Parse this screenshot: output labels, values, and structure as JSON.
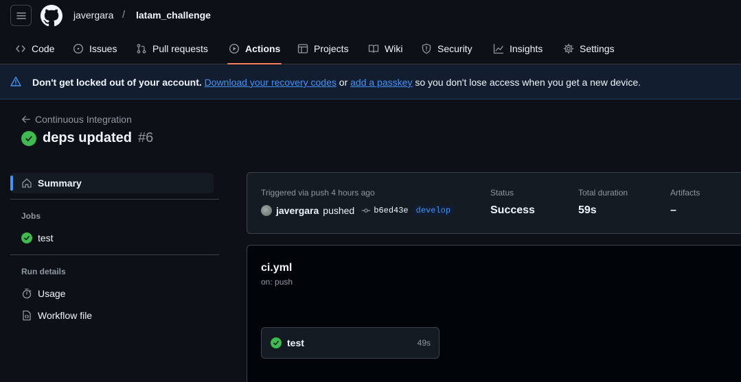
{
  "header": {
    "owner": "javergara",
    "separator": "/",
    "repo": "latam_challenge"
  },
  "tabs": [
    {
      "label": "Code",
      "icon": "code-icon"
    },
    {
      "label": "Issues",
      "icon": "issue-icon"
    },
    {
      "label": "Pull requests",
      "icon": "pull-request-icon"
    },
    {
      "label": "Actions",
      "icon": "play-icon",
      "active": true
    },
    {
      "label": "Projects",
      "icon": "table-icon"
    },
    {
      "label": "Wiki",
      "icon": "book-icon"
    },
    {
      "label": "Security",
      "icon": "shield-icon"
    },
    {
      "label": "Insights",
      "icon": "graph-icon"
    },
    {
      "label": "Settings",
      "icon": "gear-icon"
    }
  ],
  "banner": {
    "bold": "Don't get locked out of your account.",
    "link1": "Download your recovery codes",
    "mid": "or",
    "link2": "add a passkey",
    "tail": "so you don't lose access when you get a new device."
  },
  "run": {
    "back_label": "Continuous Integration",
    "title": "deps updated",
    "number": "#6"
  },
  "sidebar": {
    "summary": "Summary",
    "jobs_heading": "Jobs",
    "job": "test",
    "run_details_heading": "Run details",
    "usage": "Usage",
    "workflow_file": "Workflow file"
  },
  "summary": {
    "trigger": "Triggered via push 4 hours ago",
    "actor": "javergara",
    "action": "pushed",
    "sha": "b6ed43e",
    "branch": "develop",
    "status_label": "Status",
    "status_value": "Success",
    "duration_label": "Total duration",
    "duration_value": "59s",
    "artifacts_label": "Artifacts",
    "artifacts_value": "–"
  },
  "workflow": {
    "file": "ci.yml",
    "on": "on: push",
    "job_name": "test",
    "job_duration": "49s"
  },
  "colors": {
    "background": "#0d1117",
    "success": "#3fb950",
    "accent": "#4493f8",
    "active_tab": "#f78166"
  }
}
